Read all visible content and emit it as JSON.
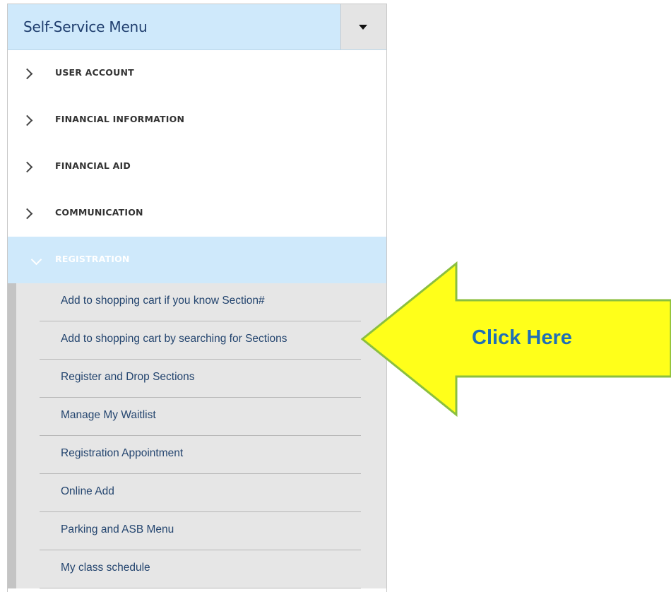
{
  "menu": {
    "title": "Self-Service Menu",
    "toggle_icon": "caret-down-icon",
    "categories": [
      {
        "label": "USER ACCOUNT",
        "expanded": false
      },
      {
        "label": "FINANCIAL INFORMATION",
        "expanded": false
      },
      {
        "label": "FINANCIAL AID",
        "expanded": false
      },
      {
        "label": "COMMUNICATION",
        "expanded": false
      },
      {
        "label": "REGISTRATION",
        "expanded": true
      }
    ],
    "registration_items": [
      "Add to shopping cart if you know Section#",
      "Add to shopping cart by searching for Sections",
      "Register and Drop Sections",
      "Manage My Waitlist",
      "Registration Appointment",
      "Online Add",
      "Parking and ASB Menu",
      "My class schedule"
    ]
  },
  "callout": {
    "text": "Click Here",
    "fill_color": "#ffff1a",
    "stroke_color": "#8bbf3f",
    "text_color": "#1f6fb6"
  },
  "colors": {
    "header_bg": "#cfe9fb",
    "active_bg": "#cfe9fb",
    "submenu_bg": "#e6e6e6",
    "submenu_text": "#24456f"
  }
}
